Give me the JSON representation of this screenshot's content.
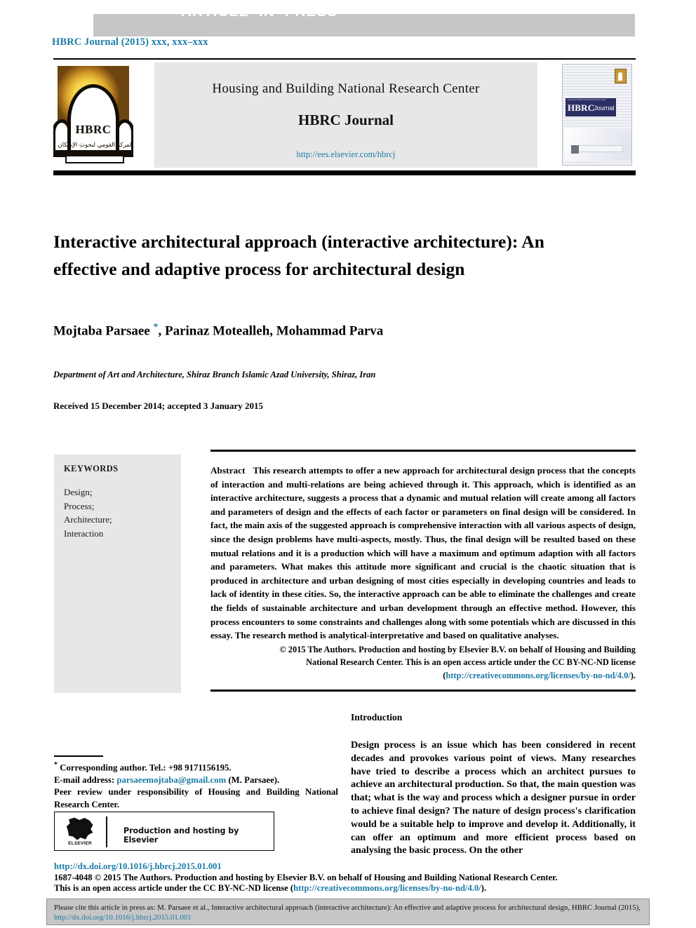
{
  "banner": {
    "label": "ARTICLE  IN  PRESS"
  },
  "journal_line": "HBRC Journal (2015) xxx, xxx–xxx",
  "masthead": {
    "organization": "Housing and Building National Research Center",
    "journal_name": "HBRC Journal",
    "submission_url": "http://ees.elsevier.com/hbrcj",
    "logo": {
      "acronym": "HBRC",
      "arabic_caption": "المركز القومي لبحوث الإسكان والبناء"
    },
    "cover": {
      "masthead_small": "Housing and Building National Research Center",
      "title_bold": "HBRC",
      "title_light": "Journal"
    }
  },
  "article": {
    "title": "Interactive architectural approach (interactive architecture): An effective and adaptive process for architectural design",
    "authors_before_star": "Mojtaba Parsaee ",
    "corresponding_marker": "*",
    "authors_after_star": ", Parinaz Motealleh, Mohammad Parva",
    "affiliation": "Department of Art and Architecture, Shiraz Branch Islamic Azad University, Shiraz, Iran",
    "history": "Received 15 December 2014; accepted 3 January 2015"
  },
  "keywords": {
    "heading": "KEYWORDS",
    "items": "Design;\nProcess;\nArchitecture;\nInteraction"
  },
  "abstract": {
    "label": "Abstract",
    "body": "This research attempts to offer a new approach for architectural design process that the concepts of interaction and multi-relations are being achieved through it. This approach, which is identified as an interactive architecture, suggests a process that a dynamic and mutual relation will create among all factors and parameters of design and the effects of each factor or parameters on final design will be considered. In fact, the main axis of the suggested approach is comprehensive interaction with all various aspects of design, since the design problems have multi-aspects, mostly. Thus, the final design will be resulted based on these mutual relations and it is a production which will have a maximum and optimum adaption with all factors and parameters. What makes this attitude more significant and crucial is the chaotic situation that is produced in architecture and urban designing of most cities especially in developing countries and leads to lack of identity in these cities. So, the interactive approach can be able to eliminate the challenges and create the fields of sustainable architecture and urban development through an effective method. However, this process encounters to some constraints and challenges along with some potentials which are discussed in this essay. The research method is analytical-interpretative and based on qualitative analyses.",
    "copyright_line1": "© 2015 The Authors. Production and hosting by Elsevier B.V. on behalf of Housing and Building",
    "copyright_line2_pre": "National Research Center.  This is an open access article under the CC BY-NC-ND license (",
    "copyright_link": "http://creativecommons.org/licenses/by-no-nd/4.0/",
    "copyright_line2_post": ")."
  },
  "introduction": {
    "heading": "Introduction",
    "body": "Design process is an issue which has been considered in recent decades and provokes various point of views. Many researches have tried to describe a process which an architect pursues to achieve an architectural production. So that, the main question was that; what is the way and process which a designer pursue in order to achieve final design? The nature of design process's clarification would be a suitable help to improve and develop it. Additionally, it can offer an optimum and more efficient process based on analysing the basic process. On the other"
  },
  "footnote": {
    "corresponding": "Corresponding author. Tel.: +98 9171156195.",
    "email_label": "E-mail address:",
    "email": "parsaeemojtaba@gmail.com",
    "email_suffix": "(M. Parsaee).",
    "peer_review": "Peer review under responsibility of Housing and Building National Research Center.",
    "elsevier_box": {
      "logo_word": "ELSEVIER",
      "text": "Production and hosting by Elsevier"
    }
  },
  "legal": {
    "doi": "http://dx.doi.org/10.1016/j.hbrcj.2015.01.001",
    "line1": "1687-4048 © 2015 The Authors. Production and hosting by Elsevier B.V. on behalf of Housing and Building National Research Center.",
    "line2_pre": "This is an open access article under the CC BY-NC-ND license (",
    "line2_link": "http://creativecommons.org/licenses/by-no-nd/4.0/",
    "line2_post": ")."
  },
  "cite": {
    "line1": "Please cite this article in press as: M. Parsaee et al., Interactive architectural approach (interactive architecture): An effective and adaptive process for architectural",
    "line2_pre": "design,  HBRC Journal (2015), ",
    "line2_link": "http://dx.doi.org/10.1016/j.hbrcj.2015.01.001"
  },
  "colors": {
    "link": "#1b7ba6",
    "banner_bg": "#c6c6c6",
    "panel_bg": "#e7e7e7",
    "cite_bg": "#c6c6c6"
  }
}
